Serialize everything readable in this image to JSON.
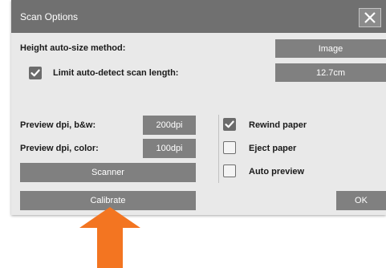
{
  "dialog": {
    "title": "Scan Options",
    "height_method_label": "Height auto-size method:",
    "height_method_value": "Image",
    "limit_scan": {
      "label": "Limit auto-detect scan length:",
      "checked": true,
      "value": "12.7cm"
    },
    "preview_bw": {
      "label": "Preview dpi, b&w:",
      "value": "200dpi"
    },
    "preview_color": {
      "label": "Preview dpi, color:",
      "value": "100dpi"
    },
    "scanner_label": "Scanner",
    "calibrate_label": "Calibrate",
    "ok_label": "OK",
    "options": [
      {
        "label": "Rewind paper",
        "checked": true
      },
      {
        "label": "Eject paper",
        "checked": false
      },
      {
        "label": "Auto preview",
        "checked": false
      }
    ]
  },
  "colors": {
    "titlebar": "#707070",
    "button": "#808080",
    "dialog_bg": "#e9e9e9",
    "arrow": "#f37521"
  },
  "icons": [
    "close-icon",
    "checkmark-icon",
    "pointer-arrow-icon"
  ]
}
